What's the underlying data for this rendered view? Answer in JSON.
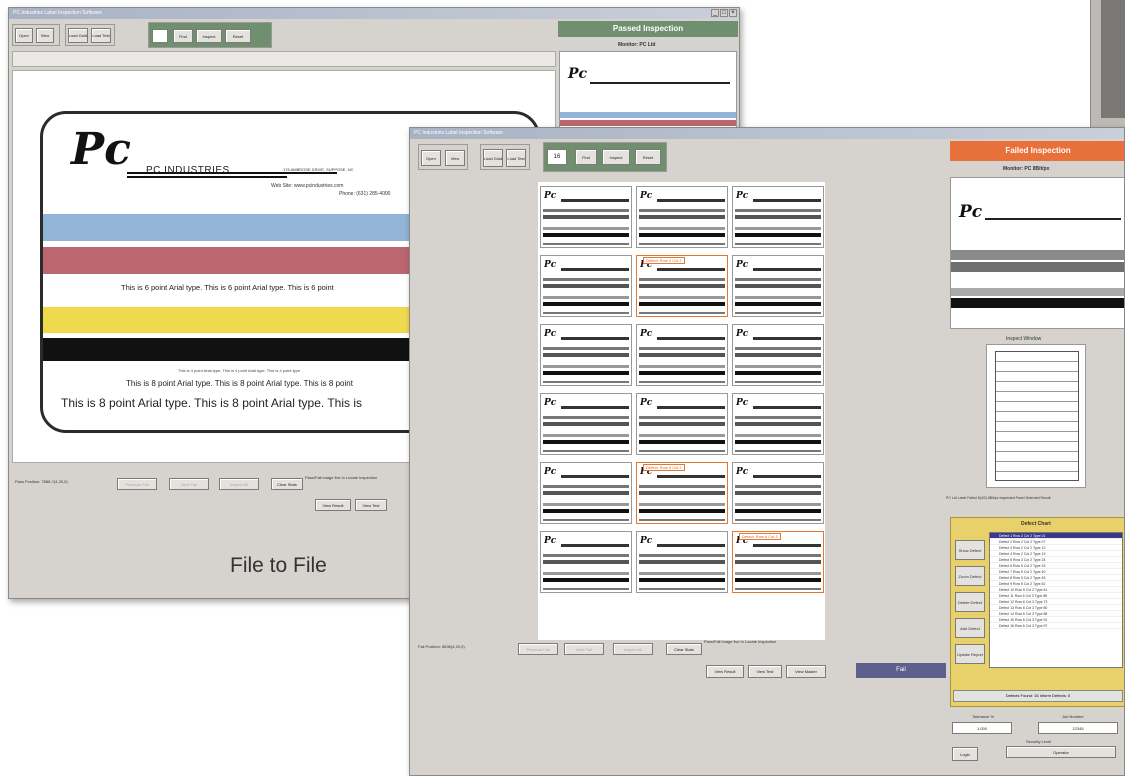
{
  "caption": "File to File",
  "back_window": {
    "title": "PC Industries Label Inspection Software",
    "toolbar": {
      "open_label": "Open",
      "view_label": "View",
      "load_gold_label": "Load Gold",
      "load_test_label": "Load Test",
      "find_label": "Find",
      "inspect_label": "Inspect",
      "reset_label": "Reset"
    },
    "status": "Passed Inspection",
    "monitor_label": "Monitor: PC Ltd",
    "label": {
      "company": "PC INDUSTRIES",
      "address": "176 AMBROSE DRIVE, SUPPOSE, NC",
      "website": "Web Site: www.pcindustries.com",
      "phone": "Phone: (631) 285-4000",
      "line_6pt": "This is 6 point Arial type. This is 6 point Arial type. This is 6 point",
      "line_4pt": "This is 4 point Arial type. This is 4 point Arial type. This is 4 point type",
      "line_8pt": "This is 8 point Arial type. This is 8 point Arial type. This is 8 point",
      "line_large": "This is 8 point Arial type. This is 8 point Arial type. This is"
    },
    "bottom": {
      "position_label": "Pass Position: 7888-7(4,20,0)",
      "btn1": "Previous Fail",
      "btn2": "Next Fail",
      "btn3": "Inspect All",
      "btn4": "Clear Stats",
      "note": "Pass/Fail image live in Locate Inspection",
      "view_result": "View Result",
      "view_test": "View Test"
    }
  },
  "front_window": {
    "title": "PC Industries Label Inspection Software",
    "toolbar": {
      "open_label": "Open",
      "view_label": "View",
      "load_gold_label": "Load Gold",
      "load_test_label": "Load Test",
      "count_value": "16",
      "find_label": "Find",
      "inspect_label": "Inspect",
      "reset_label": "Reset"
    },
    "status": "Failed Inspection",
    "monitor_label": "Monitor: PC 8Bit/px",
    "inspect_window_label": "Inspect Window",
    "status_line": "PC Ltd Label Failed 5(4/0) 8Bit/px Inspected Panel Detected Result",
    "thumbs": [
      {
        "defect": false,
        "tag": ""
      },
      {
        "defect": false,
        "tag": ""
      },
      {
        "defect": false,
        "tag": ""
      },
      {
        "defect": false,
        "tag": ""
      },
      {
        "defect": true,
        "tag": "Defect: Row 2 Col 2"
      },
      {
        "defect": false,
        "tag": ""
      },
      {
        "defect": false,
        "tag": ""
      },
      {
        "defect": false,
        "tag": ""
      },
      {
        "defect": false,
        "tag": ""
      },
      {
        "defect": false,
        "tag": ""
      },
      {
        "defect": false,
        "tag": ""
      },
      {
        "defect": false,
        "tag": ""
      },
      {
        "defect": false,
        "tag": ""
      },
      {
        "defect": true,
        "tag": "Defect: Row 5 Col 2"
      },
      {
        "defect": false,
        "tag": ""
      },
      {
        "defect": false,
        "tag": ""
      },
      {
        "defect": false,
        "tag": ""
      },
      {
        "defect": true,
        "tag": "Defect: Row 6 Col 3"
      }
    ],
    "defect_box": {
      "title": "Defect Chart",
      "buttons": [
        "Show Defect",
        "Zoom Defect",
        "Delete Defect",
        "Add Defect",
        "Update Report"
      ],
      "rows": [
        "Defect 1 Row 2 Col 2 Type 01",
        "Defect 2 Row 2 Col 2 Type 07",
        "Defect 3 Row 2 Col 2 Type 12",
        "Defect 4 Row 2 Col 2 Type 19",
        "Defect 5 Row 2 Col 2 Type 24",
        "Defect 6 Row 5 Col 2 Type 33",
        "Defect 7 Row 5 Col 2 Type 40",
        "Defect 8 Row 5 Col 2 Type 45",
        "Defect 9 Row 5 Col 2 Type 52",
        "Defect 10 Row 5 Col 2 Type 61",
        "Defect 11 Row 6 Col 3 Type 68",
        "Defect 12 Row 6 Col 3 Type 73",
        "Defect 13 Row 6 Col 3 Type 80",
        "Defect 14 Row 6 Col 3 Type 88",
        "Defect 15 Row 6 Col 3 Type 91",
        "Defect 16 Row 6 Col 3 Type 97"
      ],
      "footer": "Defects Found: 16   Inform Defects: 0"
    },
    "bottom_fields": {
      "tolerance_label": "Tolerance %",
      "tolerance_value": "1.000",
      "job_number_label": "Job Number",
      "job_number_value": "12345",
      "login_label": "Login",
      "security_level_label": "Security Level",
      "operator_value": "Operator"
    },
    "bottom": {
      "position_label": "Fail Position: 8836(4,20,0)",
      "btn1": "Previous Fail",
      "btn2": "Next Fail",
      "btn3": "Inspect All",
      "btn4": "Clear Stats",
      "note": "Pass/Fail image live in Locate Inspection",
      "view_result": "View Result",
      "view_test": "View Test",
      "view_master": "View Master",
      "result": "Fail"
    }
  },
  "colors": {
    "pass_green": "#6f8f6f",
    "fail_orange": "#e8703a",
    "defect_yellow": "#e8d16a",
    "stripe_blue": "#92b4d6",
    "stripe_red": "#bb6670",
    "stripe_yellow": "#efd94c"
  }
}
